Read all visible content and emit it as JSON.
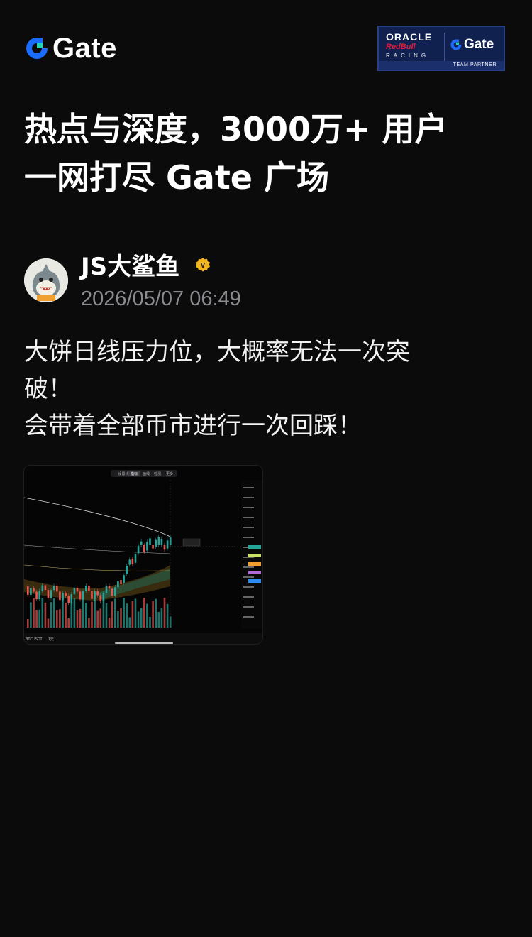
{
  "header": {
    "logo_text": "Gate",
    "partner": {
      "oracle": "ORACLE",
      "redbull": "RedBull",
      "racing": "RACING",
      "gate": "Gate",
      "team_partner": "TEAM PARTNER"
    }
  },
  "headline": {
    "line1": "热点与深度，3000万+ 用户",
    "line2": "一网打尽 Gate 广场"
  },
  "author": {
    "name": "JS大鲨鱼",
    "verified_badge": "V",
    "timestamp": "2026/05/07 06:49"
  },
  "post": {
    "lines": [
      "大饼日线压力位，大概率无法一次突",
      "破！",
      "会带着全部币市进行一次回踩！"
    ]
  },
  "chart_image": {
    "tabs": [
      "设置线",
      "指标",
      "画线",
      "检测",
      "更多"
    ],
    "pair": "BTCUSDT",
    "interval": "1天",
    "colors": {
      "up": "#26a69a",
      "down": "#ef5350"
    }
  },
  "colors": {
    "background": "#0b0b0c",
    "gate_blue": "#1a6cff",
    "gate_green": "#20d6b5",
    "verify_gold": "#f2b51e",
    "muted": "#8a8a8f"
  }
}
